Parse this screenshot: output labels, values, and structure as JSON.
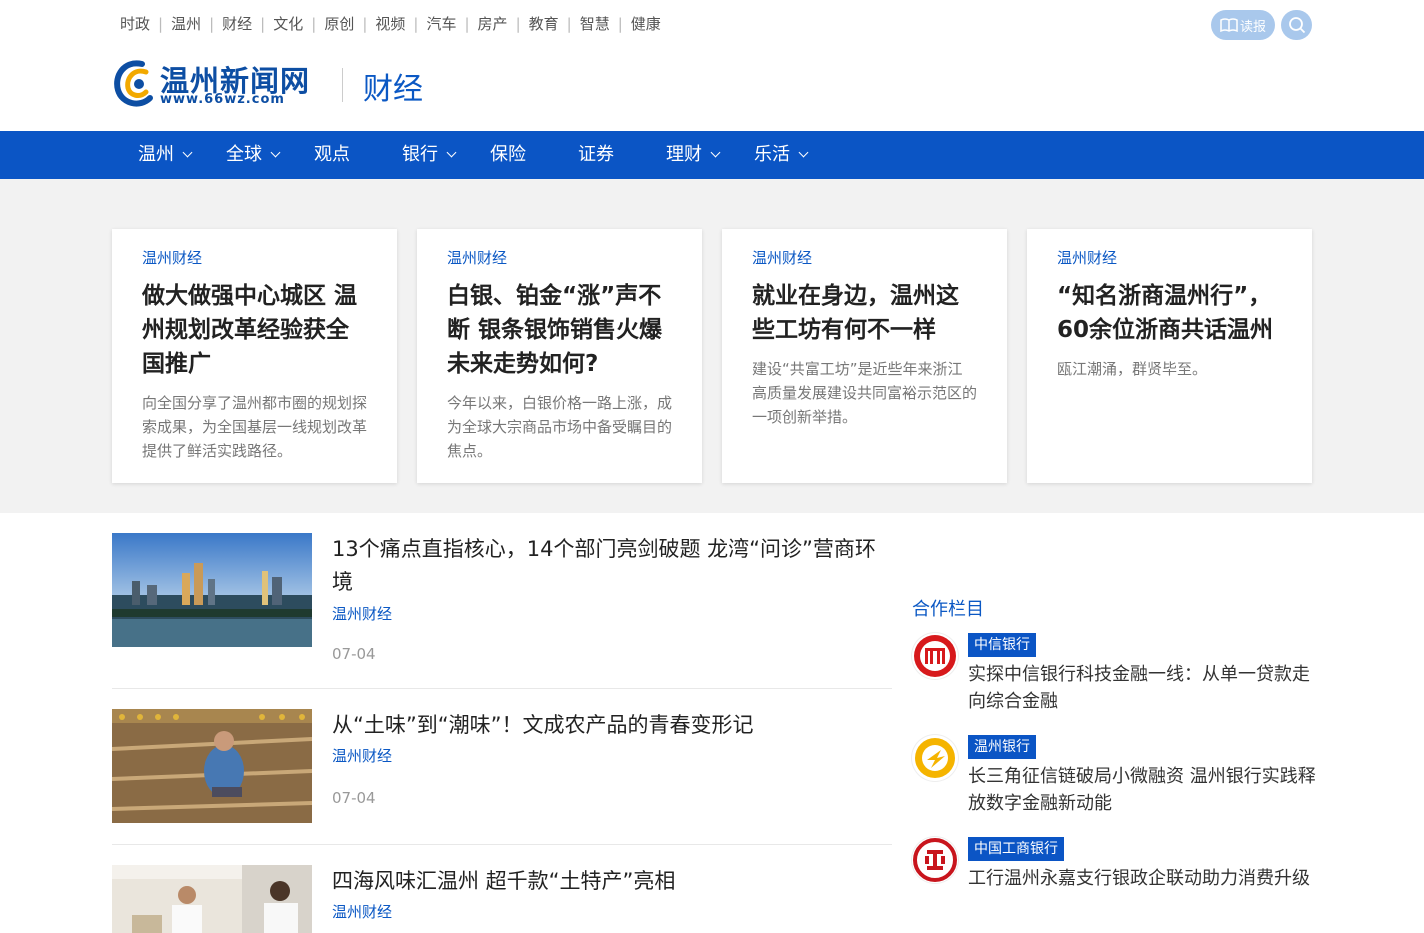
{
  "top_nav": [
    "时政",
    "温州",
    "财经",
    "文化",
    "原创",
    "视频",
    "汽车",
    "房产",
    "教育",
    "智慧",
    "健康"
  ],
  "reader_label": "读报",
  "logo": {
    "name": "温州新闻网",
    "url": "www.66wz.com"
  },
  "section_title": "财经",
  "main_nav": [
    {
      "label": "温州",
      "dropdown": true
    },
    {
      "label": "全球",
      "dropdown": true
    },
    {
      "label": "观点",
      "dropdown": false
    },
    {
      "label": "银行",
      "dropdown": true
    },
    {
      "label": "保险",
      "dropdown": false
    },
    {
      "label": "证券",
      "dropdown": false
    },
    {
      "label": "理财",
      "dropdown": true
    },
    {
      "label": "乐活",
      "dropdown": true
    }
  ],
  "featured": [
    {
      "category": "温州财经",
      "title": "做大做强中心城区 温州规划改革经验获全国推广",
      "desc": "向全国分享了温州都市圈的规划探索成果，为全国基层一线规划改革提供了鲜活实践路径。"
    },
    {
      "category": "温州财经",
      "title": "白银、铂金“涨”声不断 银条银饰销售火爆 未来走势如何?",
      "desc": "今年以来，白银价格一路上涨，成为全球大宗商品市场中备受瞩目的焦点。"
    },
    {
      "category": "温州财经",
      "title": "就业在身边，温州这些工坊有何不一样",
      "desc": "建设“共富工坊”是近些年来浙江高质量发展建设共同富裕示范区的一项创新举措。"
    },
    {
      "category": "温州财经",
      "title": "“知名浙商温州行”，60余位浙商共话温州",
      "desc": "瓯江潮涌，群贤毕至。"
    }
  ],
  "news": [
    {
      "title": "13个痛点直指核心，14个部门亮剑破题 龙湾“问诊”营商环境",
      "category": "温州财经",
      "date": "07-04"
    },
    {
      "title": "从“土味”到“潮味”！文成农产品的青春变形记",
      "category": "温州财经",
      "date": "07-04"
    },
    {
      "title": "四海风味汇温州 超千款“土特产”亮相",
      "category": "温州财经",
      "date": ""
    }
  ],
  "partners": {
    "heading": "合作栏目",
    "items": [
      {
        "badge": "中信银行",
        "title": "实探中信银行科技金融一线：从单一贷款走向综合金融",
        "icon": "citic-bank-logo"
      },
      {
        "badge": "温州银行",
        "title": "长三角征信链破局小微融资 温州银行实践释放数字金融新动能",
        "icon": "wenzhou-bank-logo"
      },
      {
        "badge": "中国工商银行",
        "title": "工行温州永嘉支行银政企联动助力消费升级",
        "icon": "icbc-logo"
      }
    ]
  },
  "colors": {
    "brand_blue": "#0b55c5",
    "accent_blue": "#0b58c4",
    "band_gray": "#f2f2f2"
  }
}
